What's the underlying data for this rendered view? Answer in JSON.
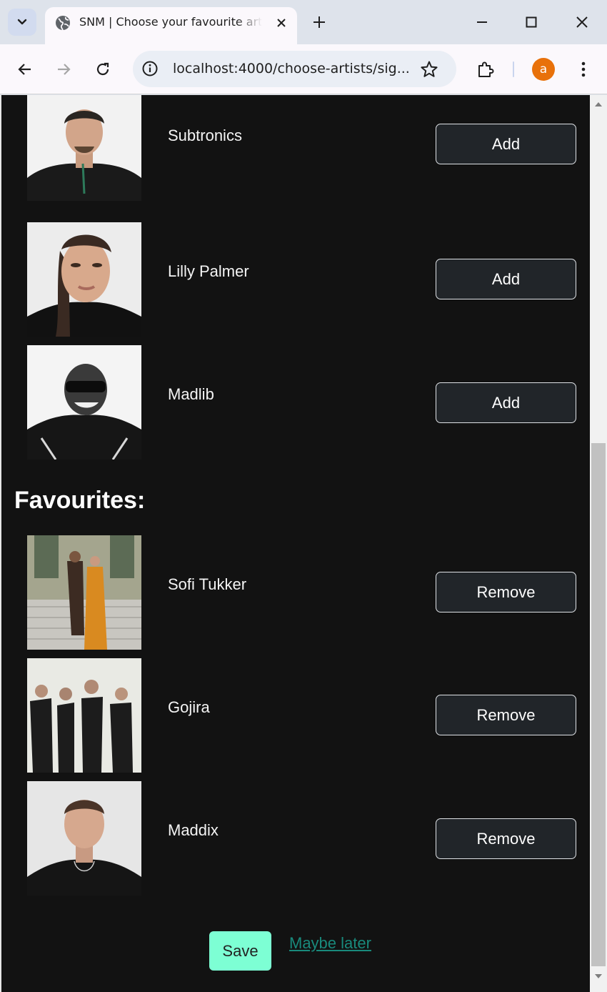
{
  "browser": {
    "tab_title": "SNM | Choose your favourite artists",
    "url": "localhost:4000/choose-artists/sig...",
    "profile_initial": "a"
  },
  "page": {
    "suggested_artists": [
      {
        "name": "Subtronics",
        "action": "Add"
      },
      {
        "name": "Lilly Palmer",
        "action": "Add"
      },
      {
        "name": "Madlib",
        "action": "Add"
      }
    ],
    "favourites_heading": "Favourites:",
    "favourite_artists": [
      {
        "name": "Sofi Tukker",
        "action": "Remove"
      },
      {
        "name": "Gojira",
        "action": "Remove"
      },
      {
        "name": "Maddix",
        "action": "Remove"
      }
    ],
    "save_label": "Save",
    "maybe_later_label": "Maybe later"
  },
  "colors": {
    "page_background": "#121212",
    "button_background": "#212529",
    "save_accent": "#7dffd4",
    "link": "#198a7c",
    "avatar": "#e8710a"
  },
  "icons": [
    "tab-search-icon",
    "globe-icon",
    "close-icon",
    "plus-icon",
    "minimize-icon",
    "maximize-icon",
    "back-icon",
    "forward-icon",
    "reload-icon",
    "site-info-icon",
    "star-icon",
    "extensions-icon",
    "menu-icon"
  ]
}
